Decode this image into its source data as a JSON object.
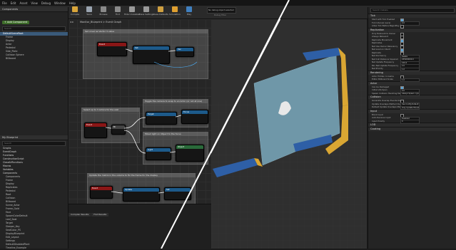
{
  "menu": [
    "File",
    "Edit",
    "Asset",
    "View",
    "Debug",
    "Window",
    "Help"
  ],
  "toolbar": {
    "buttons": [
      {
        "name": "compile",
        "label": "Compile",
        "color": "#d9a53a"
      },
      {
        "name": "save",
        "label": "Save",
        "color": "#9aa4b0"
      },
      {
        "name": "browse",
        "label": "Browse",
        "color": "#8a8a8a"
      },
      {
        "name": "find",
        "label": "Find",
        "color": "#8a8a8a"
      },
      {
        "name": "hide-unrelated",
        "label": "Hide Unrelated",
        "color": "#9a9a9a"
      },
      {
        "name": "class-settings",
        "label": "Class Settings",
        "color": "#9a9a9a"
      },
      {
        "name": "class-defaults",
        "label": "Class Defaults",
        "color": "#d0a040"
      },
      {
        "name": "simulation",
        "label": "Simulation",
        "color": "#e0a030"
      },
      {
        "name": "play",
        "label": "Play",
        "color": "#4080c0"
      }
    ],
    "debug_filter": "No debug object selected",
    "debug_label": "Debug Filter"
  },
  "components": {
    "title": "Components",
    "add_label": "+ Add Component",
    "search_placeholder": "Search",
    "items": [
      "DefaultSceneRoot",
      "Frame",
      "Display",
      "Actor",
      "Pedestal",
      "Side_Plate",
      "Collision Sphere",
      "Billboard"
    ]
  },
  "my_blueprint": {
    "title": "My Blueprint",
    "search_placeholder": "Search",
    "sections": [
      "Graphs",
      "EventGraph",
      "Functions",
      "ConstructionScript",
      "CloseAllFunctions",
      "Macros",
      "Variables",
      "Components"
    ],
    "variables": [
      "Components",
      "Frame",
      "Display",
      "Replicates",
      "Pedestal",
      "Root",
      "Collision",
      "Billboard",
      "Scene_Actor",
      "Frame_Gold",
      "Face",
      "SpawnColorDefault",
      "Leaf_Seat",
      "Target",
      "Sleeper_Key",
      "SeatColor_PS",
      "DisplayBlueprint",
      "Edit_Layout",
      "Settings",
      "DefaultDisabledPlant",
      "Timeline_Example"
    ]
  },
  "graph": {
    "breadcrumb": "Monitor_Blueprint > Event Graph",
    "comments": [
      "Set cover as Vector 3 value",
      "Select up to 3 Actors for the wall",
      "Toggle the camera to snap to an Actor (or not at one)",
      "Mixed light on Object to the focus",
      "Update the matrix in the volume to fix the frame for the display"
    ]
  },
  "viewport": {
    "label": "Perspective"
  },
  "details": {
    "search_placeholder": "Search Details",
    "sections": [
      {
        "title": "Tick",
        "props": [
          {
            "l": "Start with Tick Enabled",
            "t": "chk",
            "v": true
          },
          {
            "l": "Tick Interval (secs)",
            "t": "val",
            "v": "0.0"
          },
          {
            "l": "Allow Tick Before BeginPlay",
            "t": "chk",
            "v": false
          }
        ]
      },
      {
        "title": "Replication",
        "props": [
          {
            "l": "Only Relevant to Owner",
            "t": "chk",
            "v": false
          },
          {
            "l": "Always Relevant",
            "t": "chk",
            "v": false
          },
          {
            "l": "Replicate Movement",
            "t": "chk",
            "v": true
          },
          {
            "l": "Replicates",
            "t": "chk",
            "v": false
          },
          {
            "l": "Net Use Owner Relevancy",
            "t": "chk",
            "v": false
          },
          {
            "l": "Net Load on Client",
            "t": "chk",
            "v": true
          },
          {
            "l": "Replicate",
            "t": "chk",
            "v": false
          },
          {
            "l": "Net Dormancy",
            "t": "val",
            "v": "Awake"
          },
          {
            "l": "Net Cull Distance Squared",
            "t": "val",
            "v": "225000000.0"
          },
          {
            "l": "Net Update Frequency",
            "t": "val",
            "v": "100.0"
          },
          {
            "l": "Min Net Update Frequency",
            "t": "val",
            "v": "2.0"
          },
          {
            "l": "Net Priority",
            "t": "val",
            "v": "1.0"
          }
        ]
      },
      {
        "title": "Rendering",
        "props": [
          {
            "l": "Actor Hidden In Game",
            "t": "chk",
            "v": false
          },
          {
            "l": "Editor Billboard Scale",
            "t": "val",
            "v": "1.0"
          }
        ]
      },
      {
        "title": "Actor",
        "props": [
          {
            "l": "Can be Damaged",
            "t": "chk",
            "v": true
          },
          {
            "l": "Initial Life Span",
            "t": "val",
            "v": "0.0"
          },
          {
            "l": "Spawn Collision Handling Method",
            "t": "val",
            "v": "Always Spawn, Ignore Collisions"
          }
        ]
      },
      {
        "title": "Collision",
        "props": [
          {
            "l": "Generate Overlap Events During Level Streaming",
            "t": "chk",
            "v": false
          },
          {
            "l": "Update Overlaps Method During Level Streaming",
            "t": "val",
            "v": "Use Config Default"
          },
          {
            "l": "Default Update Overlaps Method",
            "t": "val",
            "v": "Only Update Movable"
          }
        ]
      },
      {
        "title": "Input",
        "props": [
          {
            "l": "Block Input",
            "t": "chk",
            "v": false
          },
          {
            "l": "Auto Receive Input",
            "t": "val",
            "v": "Disabled"
          },
          {
            "l": "Input Priority",
            "t": "val",
            "v": "0"
          }
        ]
      },
      {
        "title": "LOD",
        "props": []
      },
      {
        "title": "Cooking",
        "props": []
      }
    ]
  },
  "bottom_tabs": [
    "Compiler Results",
    "Find Results"
  ]
}
